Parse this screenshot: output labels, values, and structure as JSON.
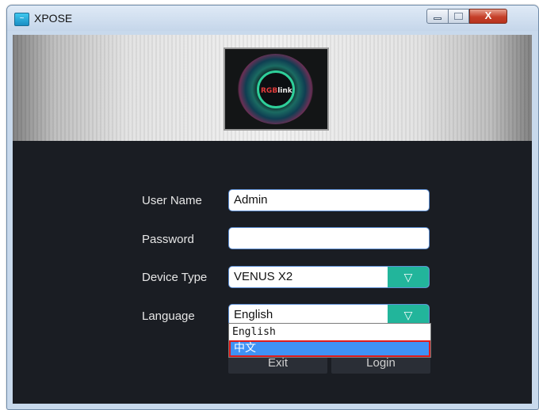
{
  "window": {
    "title": "XPOSE",
    "controls": {
      "minimize": "–",
      "maximize": "□",
      "close": "X"
    }
  },
  "banner": {
    "logo_text_a": "RGB",
    "logo_text_b": "link"
  },
  "form": {
    "username_label": "User Name",
    "username_value": "Admin",
    "password_label": "Password",
    "password_value": "",
    "device_type_label": "Device Type",
    "device_type_value": "VENUS X2",
    "language_label": "Language",
    "language_value": "English",
    "dropdown_arrow": "▽"
  },
  "buttons": {
    "exit": "Exit",
    "login": "Login"
  },
  "language_dropdown": {
    "options": [
      "English",
      "中文"
    ],
    "selected_index": 1
  },
  "colors": {
    "accent": "#22b59b",
    "highlight": "#3f92f5",
    "selection_border": "#e01c1c",
    "background": "#1a1d23"
  }
}
